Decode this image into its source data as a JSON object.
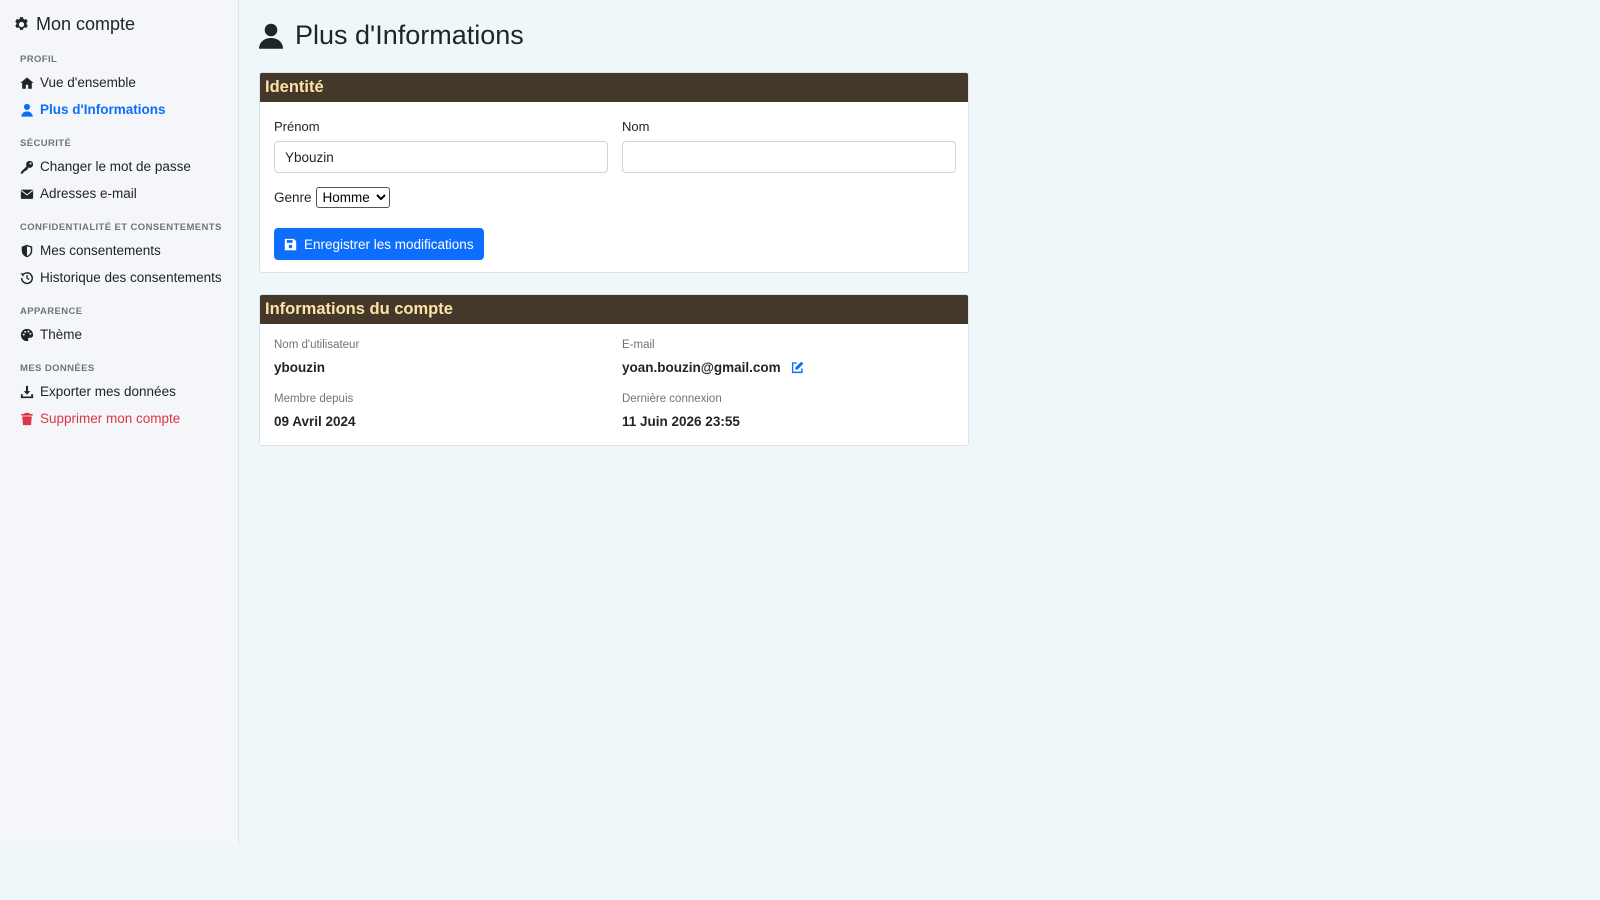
{
  "sidebar": {
    "title": "Mon compte",
    "sections": {
      "profil": "PROFIL",
      "securite": "SÉCURITÉ",
      "confidentialite": "CONFIDENTIALITÉ ET CONSENTEMENTS",
      "apparence": "APPARENCE",
      "donnees": "MES DONNÉES"
    },
    "items": {
      "overview": "Vue d'ensemble",
      "more_info": "Plus d'Informations",
      "change_password": "Changer le mot de passe",
      "emails": "Adresses e-mail",
      "consents": "Mes consentements",
      "consent_history": "Historique des consentements",
      "theme": "Thème",
      "export": "Exporter mes données",
      "delete": "Supprimer mon compte"
    }
  },
  "page": {
    "title": "Plus d'Informations"
  },
  "identity": {
    "header": "Identité",
    "first_name_label": "Prénom",
    "first_name_value": "Ybouzin",
    "last_name_label": "Nom",
    "last_name_value": "",
    "genre_label": "Genre",
    "genre_selected": "Homme",
    "save_label": "Enregistrer les modifications"
  },
  "account_info": {
    "header": "Informations du compte",
    "username_label": "Nom d'utilisateur",
    "username_value": "ybouzin",
    "email_label": "E-mail",
    "email_value": "yoan.bouzin@gmail.com",
    "member_since_label": "Membre depuis",
    "member_since_value": "09 Avril 2024",
    "last_login_label": "Dernière connexion",
    "last_login_value": "11 Juin 2026 23:55"
  },
  "colors": {
    "accent": "#0d6efd",
    "danger": "#dc3545",
    "card_header_bg": "#433829",
    "card_header_text": "#fde3a7"
  }
}
